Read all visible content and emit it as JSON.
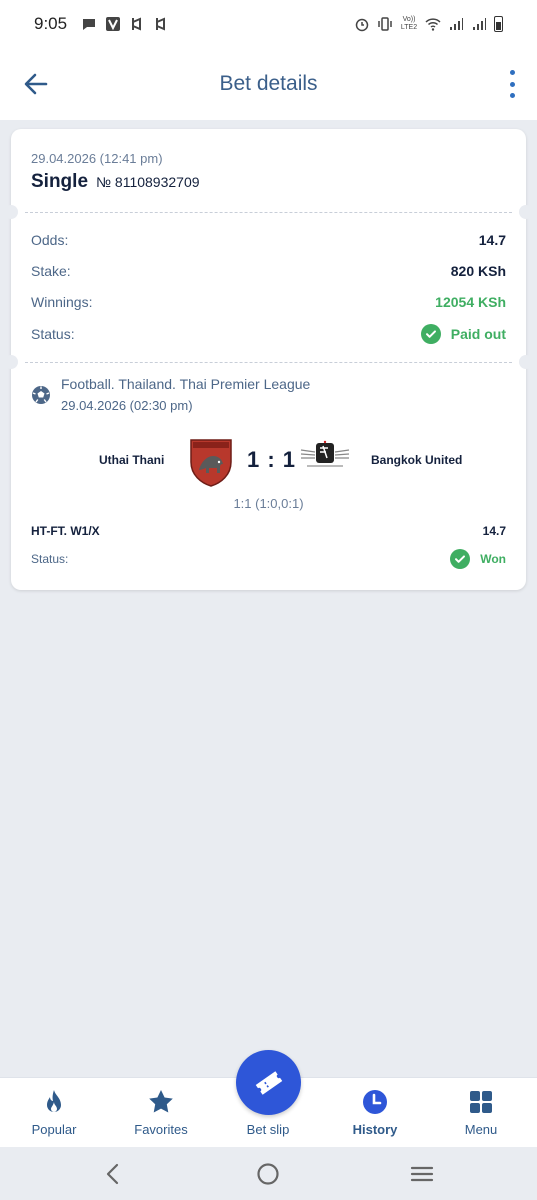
{
  "status_bar": {
    "time": "9:05",
    "network_label": "Vo)) LTE2"
  },
  "header": {
    "title": "Bet details",
    "back_icon": "arrow-left-icon",
    "menu_icon": "more-vertical-icon"
  },
  "bet": {
    "date": "29.04.2026 (12:41 pm)",
    "type": "Single",
    "number": "№ 81108932709",
    "rows": [
      {
        "label": "Odds:",
        "value": "14.7"
      },
      {
        "label": "Stake:",
        "value": "820 KSh"
      },
      {
        "label": "Winnings:",
        "value": "12054 KSh"
      },
      {
        "label": "Status:",
        "value": "Paid out"
      }
    ]
  },
  "event": {
    "league": "Football. Thailand. Thai Premier League",
    "date": "29.04.2026 (02:30 pm)",
    "home_team": "Uthai Thani",
    "away_team": "Bangkok United",
    "score": "1 : 1",
    "ht_score": "1:1 (1:0,0:1)",
    "pick": "HT-FT. W1/X",
    "pick_odds": "14.7",
    "status_label": "Status:",
    "status": "Won"
  },
  "bottom_nav": {
    "items": [
      {
        "label": "Popular",
        "icon": "flame-icon"
      },
      {
        "label": "Favorites",
        "icon": "star-icon"
      },
      {
        "label": "Bet slip",
        "icon": "ticket-icon"
      },
      {
        "label": "History",
        "icon": "clock-icon"
      },
      {
        "label": "Menu",
        "icon": "grid-icon"
      }
    ]
  },
  "colors": {
    "accent": "#2e56d8",
    "title": "#3b5f8a",
    "success": "#3fae62",
    "background": "#e9ecf1"
  }
}
